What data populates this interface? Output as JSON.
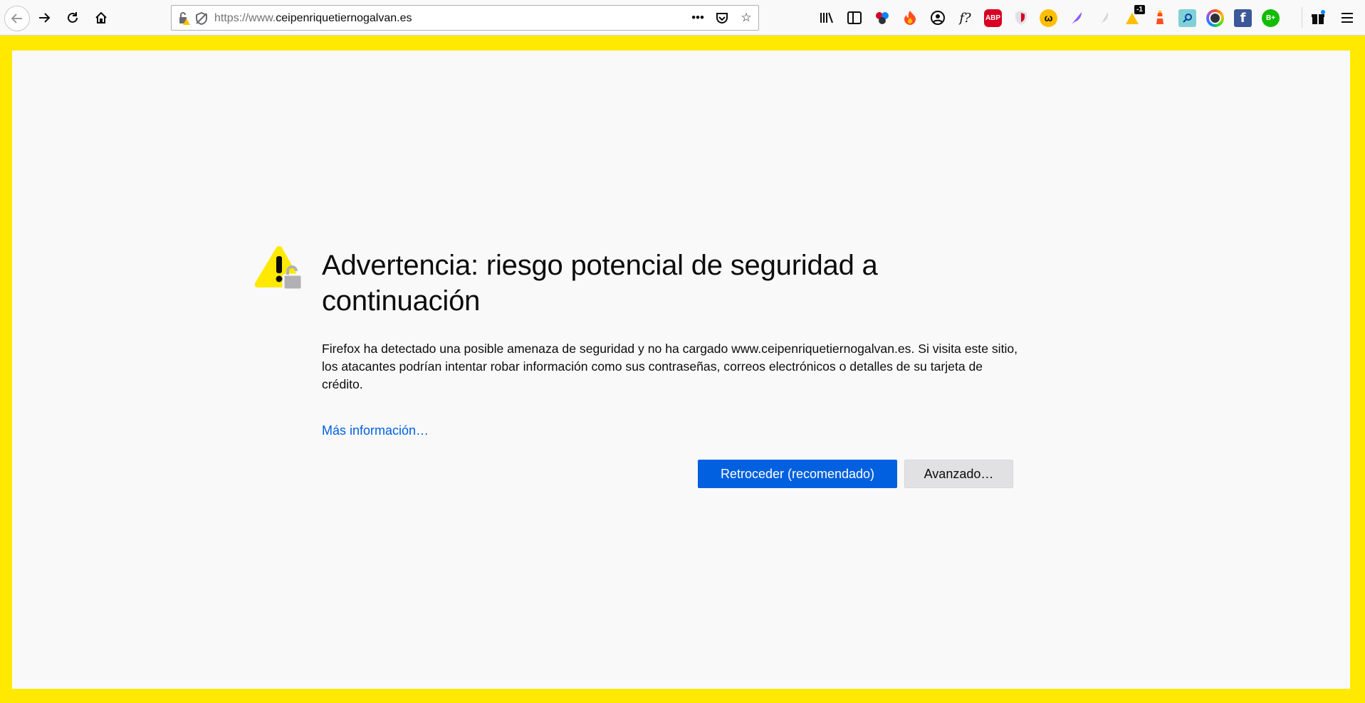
{
  "browser": {
    "url_prefix": "https://www.",
    "url_domain": "ceipenriquetiernogalvan.es",
    "extensions": [
      {
        "name": "library-icon",
        "glyph": "|||\\"
      },
      {
        "name": "sidebar-icon",
        "glyph": "▤"
      },
      {
        "name": "spheres-extension-icon",
        "glyph": "●"
      },
      {
        "name": "flame-extension-icon",
        "glyph": "🔥"
      },
      {
        "name": "account-extension-icon",
        "glyph": "◉"
      },
      {
        "name": "fontface-extension-icon",
        "glyph": "f?"
      },
      {
        "name": "adblock-plus-icon",
        "glyph": "ABP"
      },
      {
        "name": "shield-extension-icon",
        "glyph": "◈"
      },
      {
        "name": "w-extension-icon",
        "glyph": "ω"
      },
      {
        "name": "feather-extension-icon",
        "glyph": "∕"
      },
      {
        "name": "ghost-feather-extension-icon",
        "glyph": "∫"
      },
      {
        "name": "warning-extension-icon",
        "glyph": "▲",
        "badge": "-1"
      },
      {
        "name": "lighthouse-extension-icon",
        "glyph": "♜"
      },
      {
        "name": "search-extension-icon",
        "glyph": "⌕"
      },
      {
        "name": "colorful-circle-extension-icon",
        "glyph": "◎"
      },
      {
        "name": "facebook-extension-icon",
        "glyph": "f"
      },
      {
        "name": "b-plus-extension-icon",
        "glyph": "B+"
      }
    ]
  },
  "warning": {
    "title": "Advertencia: riesgo potencial de seguridad a continuación",
    "description": "Firefox ha detectado una posible amenaza de seguridad y no ha cargado www.ceipenriquetiernogalvan.es. Si visita este sitio, los atacantes podrían intentar robar información como sus contraseñas, correos electrónicos o detalles de su tarjeta de crédito.",
    "more_info": "Más información…",
    "go_back_label": "Retroceder (recomendado)",
    "advanced_label": "Avanzado…"
  },
  "colors": {
    "frame": "#ffe900",
    "page_bg": "#f9f9fa",
    "primary_button": "#0060df",
    "link": "#0060df"
  }
}
